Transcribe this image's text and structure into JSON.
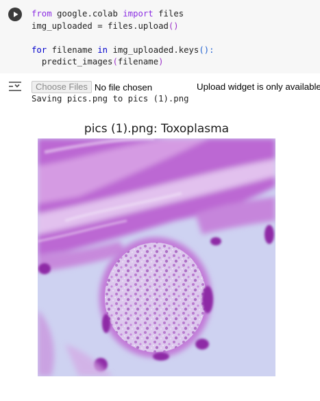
{
  "code_cell": {
    "lines": [
      {
        "kw": "from",
        "text1": " google.colab ",
        "kw2": "import",
        "text2": " files"
      },
      {
        "text": "img_uploaded = files.upload",
        "parens": "()"
      },
      {
        "blank": ""
      },
      {
        "kw": "for",
        "text1": " filename ",
        "kw2": "in",
        "text2": " img_uploaded.keys",
        "parens": "():"
      },
      {
        "indent": "  ",
        "text": "predict_images",
        "open": "(",
        "arg": "filename",
        "close": ")"
      }
    ]
  },
  "output": {
    "choose_files_label": "Choose Files",
    "no_file_text": "No file chosen",
    "upload_note": "Upload widget is only available when the cell has been executed in the current browser session.",
    "saving_text": "Saving pics.png to pics (1).png"
  },
  "plot": {
    "title": "pics (1).png: Toxoplasma"
  },
  "icons": {
    "run": "play-circle-icon",
    "output_toggle": "output-toggle-icon"
  },
  "colors": {
    "cell_background": "#f7f7f7",
    "keyword": "#8a2be2",
    "stain_purple": "#b65ccc",
    "background_slide": "#cfd3f2"
  }
}
